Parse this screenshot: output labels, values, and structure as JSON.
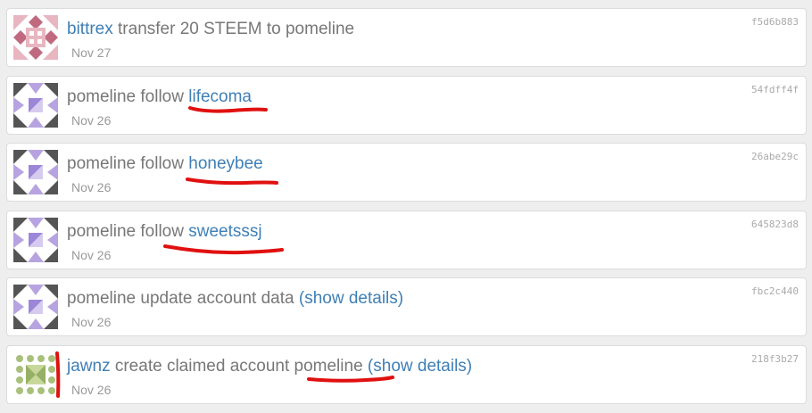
{
  "colors": {
    "link": "#3f7fb5",
    "text": "#777777",
    "date": "#999999",
    "hash": "#aaaaaa",
    "annotation": "#e01010"
  },
  "operations": [
    {
      "actor": "bittrex",
      "action": "transfer 20 STEEM to pomeline",
      "date": "Nov 27",
      "hash": "f5d6b883",
      "avatar_icon": "bittrex-identicon"
    },
    {
      "actor": "pomeline",
      "action": "follow",
      "target": "lifecoma",
      "date": "Nov 26",
      "hash": "54fdff4f",
      "avatar_icon": "pomeline-identicon"
    },
    {
      "actor": "pomeline",
      "action": "follow",
      "target": "honeybee",
      "date": "Nov 26",
      "hash": "26abe29c",
      "avatar_icon": "pomeline-identicon"
    },
    {
      "actor": "pomeline",
      "action": "follow",
      "target": "sweetsssj",
      "date": "Nov 26",
      "hash": "645823d8",
      "avatar_icon": "pomeline-identicon"
    },
    {
      "actor": "pomeline",
      "action": "update account data",
      "details_link": "(show details)",
      "date": "Nov 26",
      "hash": "fbc2c440",
      "avatar_icon": "pomeline-identicon"
    },
    {
      "actor": "jawnz",
      "action": "create claimed account",
      "target": "pomeline",
      "details_link": "(show details)",
      "date": "Nov 26",
      "hash": "218f3b27",
      "avatar_icon": "jawnz-identicon"
    }
  ]
}
